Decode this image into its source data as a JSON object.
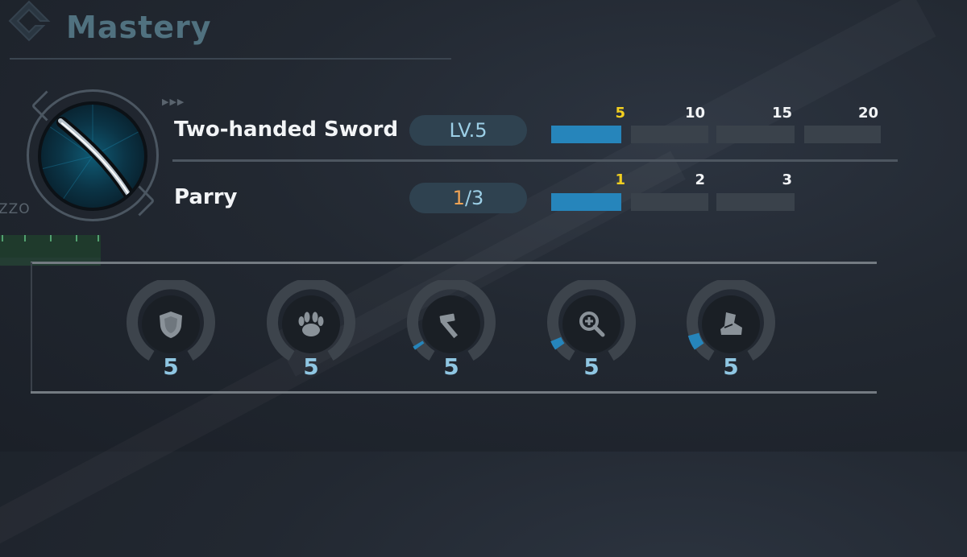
{
  "title": "Mastery",
  "side_text": "ZZO",
  "weapon": {
    "name": "Two-handed Sword",
    "level_label": "LV.5",
    "level": 5,
    "level_max": 20,
    "milestones": [
      "5",
      "10",
      "15",
      "20"
    ],
    "active_milestone": "5"
  },
  "parry": {
    "name": "Parry",
    "current": "1",
    "total": "/3",
    "value": 1,
    "max": 3,
    "milestones": [
      "1",
      "2",
      "3"
    ],
    "active_milestone": "1"
  },
  "attributes": [
    {
      "icon": "shield-icon",
      "value": "5",
      "progress": 0.0
    },
    {
      "icon": "claw-icon",
      "value": "5",
      "progress": 0.0
    },
    {
      "icon": "hammer-icon",
      "value": "5",
      "progress": 0.02
    },
    {
      "icon": "magnify-plus-icon",
      "value": "5",
      "progress": 0.05
    },
    {
      "icon": "boot-icon",
      "value": "5",
      "progress": 0.08
    }
  ],
  "colors": {
    "accent": "#2685bb",
    "milestone_active": "#f2cf20",
    "current_value": "#f0a355",
    "title": "#50717f"
  }
}
